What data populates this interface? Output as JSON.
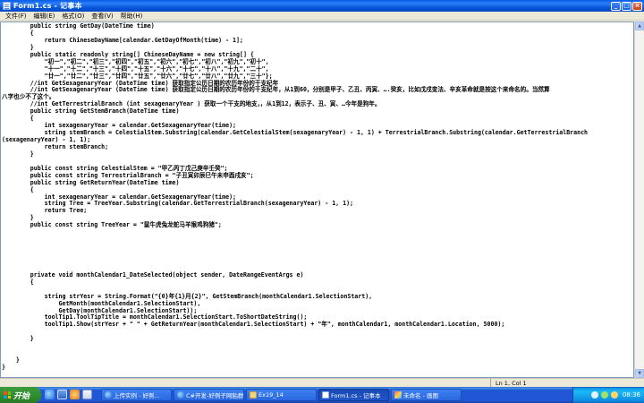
{
  "window": {
    "title": "Form1.cs - 记事本",
    "minimize_glyph": "_",
    "maximize_glyph": "□",
    "close_glyph": "×"
  },
  "menu": [
    "文件(F)",
    "编辑(E)",
    "格式(O)",
    "查看(V)",
    "帮助(H)"
  ],
  "code_lines": [
    "        public string GetDay(DateTime time)",
    "        {",
    "            return ChineseDayName[calendar.GetDayOfMonth(time) - 1];",
    "        }",
    "        public static readonly string[] ChineseDayName = new string[] {",
    "            \"初一\",\"初二\",\"初三\",\"初四\",\"初五\",\"初六\",\"初七\",\"初八\",\"初九\",\"初十\",",
    "            \"十一\",\"十二\",\"十三\",\"十四\",\"十五\",\"十六\",\"十七\",\"十八\",\"十九\",\"二十\",",
    "            \"廿一\",\"廿二\",\"廿三\",\"廿四\",\"廿五\",\"廿六\",\"廿七\",\"廿八\",\"廿九\",\"三十\"};",
    "        //int GetSexagenaryYear (DateTime time) 获取指定公历日期的农历年份的干支纪年",
    "        //int GetSexagenaryYear (DateTime time) 获取指定公历日期的农历年份的干支纪年，从1到60，分别是甲子、乙丑、丙寅、….癸亥，比如戊戌变法、辛亥革命就是按这个来命名的。当然算",
    "八字也少不了这个。",
    "        //int GetTerrestrialBranch (int sexagenaryYear ) 获取一个干支的地支，，从1到12，表示子、丑、寅、…今年是狗年。",
    "        public string GetStemBranch(DateTime time)",
    "        {",
    "            int sexagenaryYear = calendar.GetSexagenaryYear(time);",
    "            string stemBranch = CelestialStem.Substring(calendar.GetCelestialStem(sexagenaryYear) - 1, 1) + TerrestrialBranch.Substring(calendar.GetTerrestrialBranch",
    "(sexagenaryYear) - 1, 1);",
    "            return stemBranch;",
    "        }",
    "",
    "        public const string CelestialStem = \"甲乙丙丁戊己庚辛壬癸\";",
    "        public const string TerrestrialBranch = \"子丑寅卯辰巳午未申酉戌亥\";",
    "        public string GetReturnYear(DateTime time)",
    "        {",
    "            int sexagenaryYear = calendar.GetSexagenaryYear(time);",
    "            string Tree = TreeYear.Substring(calendar.GetTerrestrialBranch(sexagenaryYear) - 1, 1);",
    "            return Tree;",
    "        }",
    "        public const string TreeYear = \"鼠牛虎兔龙蛇马羊猴鸡狗猪\";",
    "",
    "",
    "",
    "",
    "",
    "",
    "        private void monthCalendar1_DateSelected(object sender, DateRangeEventArgs e)",
    "        {",
    "",
    "            string strYesr = String.Format(\"{0}年{1}月{2}\", GetStemBranch(monthCalendar1.SelectionStart),",
    "                GetMonth(monthCalendar1.SelectionStart),",
    "                GetDay(monthCalendar1.SelectionStart));",
    "            toolTip1.ToolTipTitle = monthCalendar1.SelectionStart.ToShortDateString();",
    "            toolTip1.Show(strYesr + \" \" + GetReturnYear(monthCalendar1.SelectionStart) + \"年\", monthCalendar1, monthCalendar1.Location, 5000);",
    "",
    "        }",
    "",
    "",
    "    }",
    "}"
  ],
  "status": {
    "position": "Ln 1, Col 1"
  },
  "taskbar": {
    "start_label": "开始",
    "tasks": [
      {
        "label": "上传实例 - 好例...",
        "icon": "ie"
      },
      {
        "label": "C#开发-好例子网贴群",
        "icon": "ie"
      },
      {
        "label": "Ex19_14",
        "icon": "folder"
      },
      {
        "label": "Form1.cs - 记事本",
        "icon": "notepad",
        "active": true
      },
      {
        "label": "未命名 - 画图",
        "icon": "paint"
      }
    ],
    "clock": "08:36"
  },
  "colors": {
    "titlebar": "#0453d8",
    "taskbar": "#2157d7",
    "start": "#2f8f2f",
    "tray": "#18b9f6"
  }
}
